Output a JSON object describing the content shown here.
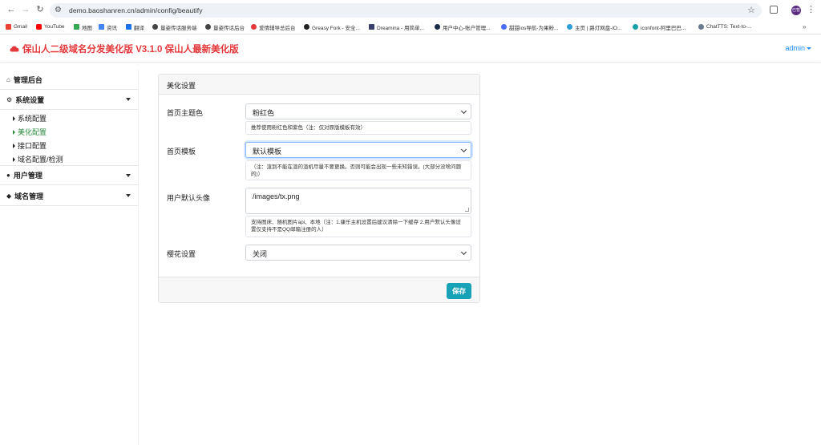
{
  "browser": {
    "url": "demo.baoshanren.cn/admin/config/beautify",
    "bookmarks": [
      {
        "label": "Gmail",
        "color": "#ea4335"
      },
      {
        "label": "YouTube",
        "color": "#ff0000"
      },
      {
        "label": "地图",
        "color": "#34a853"
      },
      {
        "label": "资讯",
        "color": "#4285f4"
      },
      {
        "label": "翻译",
        "color": "#1a73e8"
      },
      {
        "label": "量姿传话服务端",
        "color": "#444444"
      },
      {
        "label": "量姿传话后台",
        "color": "#444444"
      },
      {
        "label": "爱情辅导总后台",
        "color": "#e4393c"
      },
      {
        "label": "Greasy Fork - 安全...",
        "color": "#222222"
      },
      {
        "label": "Dreamina - 用简单...",
        "color": "#3a3f6b"
      },
      {
        "label": "用户中心-账户管理...",
        "color": "#1b2a4a"
      },
      {
        "label": "甜甜ios导航-为果粉...",
        "color": "#4a6cf7"
      },
      {
        "label": "主页 | 路灯网盘-iO...",
        "color": "#2d9cdb"
      },
      {
        "label": "iconfont-阿里巴巴...",
        "color": "#18a0a8"
      },
      {
        "label": "ChatTTS: Text-to-...",
        "color": "#6b7a8f"
      }
    ],
    "more": "»",
    "profile_initials": "已暂停"
  },
  "header": {
    "brand": "保山人二级域名分发美化版 V3.1.0 保山人最新美化版",
    "user": "admin",
    "brand_color": "#e4393c",
    "user_color": "#1e90ff"
  },
  "sidebar": {
    "dashboard": "管理后台",
    "system": "系统设置",
    "system_items": [
      "系统配置",
      "美化配置",
      "接口配置",
      "域名配置/检测"
    ],
    "users": "用户管理",
    "domains": "域名管理",
    "active_color": "#2b8a3e"
  },
  "card": {
    "title": "美化设置",
    "theme_label": "首页主题色",
    "theme_value": "粉红色",
    "theme_hint": "推荐使用粉红色和紫色（注：仅对原版模板有效）",
    "template_label": "首页模板",
    "template_value": "默认模板",
    "template_hint": "（注：渲到不能在渲的渲机尽量不要更换。否则可能会出现一些未知错误。(大部分没啥问题的)）",
    "avatar_label": "用户默认头像",
    "avatar_value": "/images/tx.png",
    "avatar_hint": "支持图床、随机图片api、本地（注：1.康乐主机设置后建议清除一下缓存 2.用户默认头像设置仅支持不是QQ邮箱注册的人）",
    "sakura_label": "樱花设置",
    "sakura_value": "关闭",
    "save_label": "保存",
    "save_color": "#17a2b8"
  }
}
